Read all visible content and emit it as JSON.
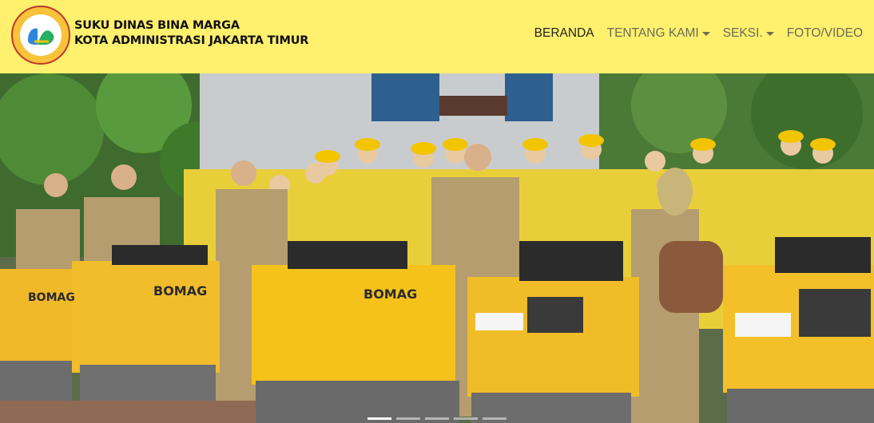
{
  "brand": {
    "line1": "SUKU DINAS BINA MARGA",
    "line2": "KOTA ADMINISTRASI JAKARTA TIMUR",
    "logo_icon": "bina-marga-seal"
  },
  "nav": {
    "items": [
      {
        "label": "BERANDA",
        "active": true,
        "dropdown": false
      },
      {
        "label": "TENTANG KAMI",
        "active": false,
        "dropdown": true
      },
      {
        "label": "SEKSI.",
        "active": false,
        "dropdown": true
      },
      {
        "label": "FOTO/VIDEO",
        "active": false,
        "dropdown": false
      }
    ]
  },
  "colors": {
    "navbar_bg": "#fff06e",
    "machine_yellow": "#f4c21a",
    "uniform_khaki": "#b8a378",
    "shirt_yellow": "#f1d63a"
  },
  "carousel": {
    "slides": 5,
    "active_index": 0,
    "machine_brand": "BOMAG"
  }
}
